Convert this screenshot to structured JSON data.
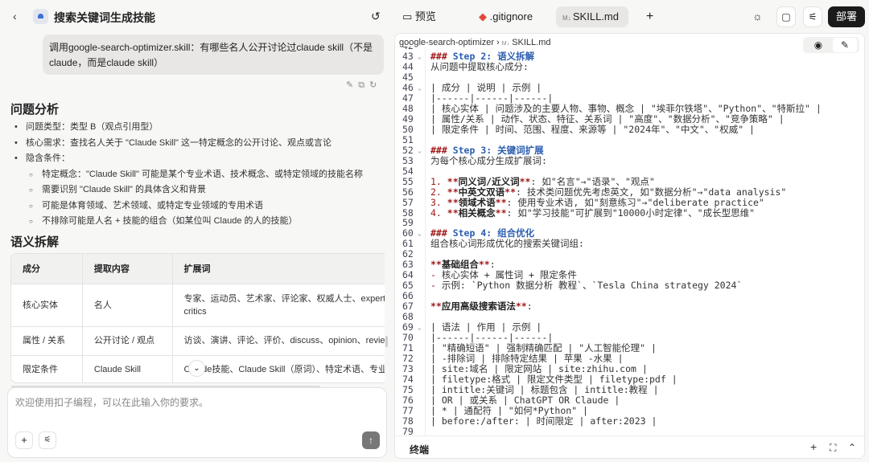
{
  "header": {
    "title": "搜索关键词生成技能"
  },
  "chat": {
    "user_message": "调用google-search-optimizer.skill：有哪些名人公开讨论过claude skill（不是claude，而是claude skill）",
    "section1": "问题分析",
    "bullets": [
      "问题类型：类型 B（观点引用型）",
      "核心需求：查找名人关于 \"Claude Skill\" 这一特定概念的公开讨论、观点或言论",
      "隐含条件："
    ],
    "sub_bullets": [
      "特定概念：\"Claude Skill\" 可能是某个专业术语、技术概念、或特定领域的技能名称",
      "需要识别 \"Claude Skill\" 的具体含义和背景",
      "可能是体育领域、艺术领域、或特定专业领域的专用术语",
      "不排除可能是人名 + 技能的组合（如某位叫 Claude 的人的技能）"
    ],
    "section2": "语义拆解",
    "table": {
      "headers": [
        "成分",
        "提取内容",
        "扩展词"
      ],
      "rows": [
        [
          "核心实体",
          "名人",
          "专家、运动员、艺术家、评论家、权威人士、experts、critics"
        ],
        [
          "属性 / 关系",
          "公开讨论 / 观点",
          "访谈、演讲、评论、评价、discuss、opinion、review、"
        ],
        [
          "限定条件",
          "Claude Skill",
          "Claude技能、Claude Skill（原词）、特定术语、专业概念"
        ]
      ]
    },
    "input_placeholder": "欢迎使用扣子编程，可以在此输入你的要求。"
  },
  "tabs": [
    {
      "label": "预览"
    },
    {
      "label": ".gitignore"
    },
    {
      "label": "SKILL.md"
    }
  ],
  "deploy_label": "部署",
  "breadcrumb": {
    "folder": "google-search-optimizer",
    "file": "SKILL.md"
  },
  "terminal_label": "终端",
  "code_lines": [
    {
      "n": "42",
      "s": []
    },
    {
      "n": "43",
      "fold": true,
      "s": [
        [
          "hm",
          "### "
        ],
        [
          "hb",
          "Step 2: 语义拆解"
        ]
      ]
    },
    {
      "n": "44",
      "s": [
        [
          "t",
          "从问题中提取核心成分:"
        ]
      ]
    },
    {
      "n": "45",
      "s": []
    },
    {
      "n": "46",
      "fold": true,
      "s": [
        [
          "t",
          "| 成分 | 说明 | 示例 |"
        ]
      ]
    },
    {
      "n": "47",
      "s": [
        [
          "t",
          "|------|------|------|"
        ]
      ]
    },
    {
      "n": "48",
      "s": [
        [
          "t",
          "| 核心实体 | 问题涉及的主要人物、事物、概念 | \"埃菲尔铁塔\"、\"Python\"、\"特斯拉\" |"
        ]
      ]
    },
    {
      "n": "49",
      "s": [
        [
          "t",
          "| 属性/关系 | 动作、状态、特征、关系词 | \"高度\"、\"数据分析\"、\"竞争策略\" |"
        ]
      ]
    },
    {
      "n": "50",
      "s": [
        [
          "t",
          "| 限定条件 | 时间、范围、程度、来源等 | \"2024年\"、\"中文\"、\"权威\" |"
        ]
      ]
    },
    {
      "n": "51",
      "s": []
    },
    {
      "n": "52",
      "fold": true,
      "s": [
        [
          "hm",
          "### "
        ],
        [
          "hb",
          "Step 3: 关键词扩展"
        ]
      ]
    },
    {
      "n": "53",
      "s": [
        [
          "t",
          "为每个核心成分生成扩展词:"
        ]
      ]
    },
    {
      "n": "54",
      "s": []
    },
    {
      "n": "55",
      "s": [
        [
          "num",
          "1. "
        ],
        [
          "bm",
          "**"
        ],
        [
          "bt",
          "同义词/近义词"
        ],
        [
          "bm",
          "**"
        ],
        [
          "t",
          ": 如\"名言\"→\"语录\"、\"观点\""
        ]
      ]
    },
    {
      "n": "56",
      "s": [
        [
          "num",
          "2. "
        ],
        [
          "bm",
          "**"
        ],
        [
          "bt",
          "中英文双语"
        ],
        [
          "bm",
          "**"
        ],
        [
          "t",
          ": 技术类问题优先考虑英文, 如\"数据分析\"→\"data analysis\""
        ]
      ]
    },
    {
      "n": "57",
      "s": [
        [
          "num",
          "3. "
        ],
        [
          "bm",
          "**"
        ],
        [
          "bt",
          "领域术语"
        ],
        [
          "bm",
          "**"
        ],
        [
          "t",
          ": 使用专业术语, 如\"刻意练习\"→\"deliberate practice\""
        ]
      ]
    },
    {
      "n": "58",
      "s": [
        [
          "num",
          "4. "
        ],
        [
          "bm",
          "**"
        ],
        [
          "bt",
          "相关概念"
        ],
        [
          "bm",
          "**"
        ],
        [
          "t",
          ": 如\"学习技能\"可扩展到\"10000小时定律\"、\"成长型思维\""
        ]
      ]
    },
    {
      "n": "59",
      "s": []
    },
    {
      "n": "60",
      "fold": true,
      "s": [
        [
          "hm",
          "### "
        ],
        [
          "hb",
          "Step 4: 组合优化"
        ]
      ]
    },
    {
      "n": "61",
      "s": [
        [
          "t",
          "组合核心词形成优化的搜索关键词组:"
        ]
      ]
    },
    {
      "n": "62",
      "s": []
    },
    {
      "n": "63",
      "s": [
        [
          "bm",
          "**"
        ],
        [
          "bt",
          "基础组合"
        ],
        [
          "bm",
          "**"
        ],
        [
          "t",
          ":"
        ]
      ]
    },
    {
      "n": "64",
      "s": [
        [
          "num",
          "- "
        ],
        [
          "t",
          "核心实体 + 属性词 + 限定条件"
        ]
      ]
    },
    {
      "n": "65",
      "s": [
        [
          "num",
          "- "
        ],
        [
          "t",
          "示例: `Python 数据分析 教程`、`Tesla China strategy 2024`"
        ]
      ]
    },
    {
      "n": "66",
      "s": []
    },
    {
      "n": "67",
      "s": [
        [
          "bm",
          "**"
        ],
        [
          "bt",
          "应用高级搜索语法"
        ],
        [
          "bm",
          "**"
        ],
        [
          "t",
          ":"
        ]
      ]
    },
    {
      "n": "68",
      "s": []
    },
    {
      "n": "69",
      "fold": true,
      "s": [
        [
          "t",
          "| 语法 | 作用 | 示例 |"
        ]
      ]
    },
    {
      "n": "70",
      "s": [
        [
          "t",
          "|------|------|------|"
        ]
      ]
    },
    {
      "n": "71",
      "s": [
        [
          "t",
          "| \"精确短语\" | 强制精确匹配 | \"人工智能伦理\" |"
        ]
      ]
    },
    {
      "n": "72",
      "s": [
        [
          "t",
          "| -排除词 | 排除特定结果 | 苹果 -水果 |"
        ]
      ]
    },
    {
      "n": "73",
      "s": [
        [
          "t",
          "| site:域名 | 限定网站 | site:zhihu.com |"
        ]
      ]
    },
    {
      "n": "74",
      "s": [
        [
          "t",
          "| filetype:格式 | 限定文件类型 | filetype:pdf |"
        ]
      ]
    },
    {
      "n": "75",
      "s": [
        [
          "t",
          "| intitle:关键词 | 标题包含 | intitle:教程 |"
        ]
      ]
    },
    {
      "n": "76",
      "s": [
        [
          "t",
          "| OR | 或关系 | ChatGPT OR Claude |"
        ]
      ]
    },
    {
      "n": "77",
      "s": [
        [
          "t",
          "| * | 通配符 | \"如何*Python\" |"
        ]
      ]
    },
    {
      "n": "78",
      "s": [
        [
          "t",
          "| before:/after: | 时间限定 | after:2023 |"
        ]
      ]
    },
    {
      "n": "79",
      "s": []
    }
  ]
}
